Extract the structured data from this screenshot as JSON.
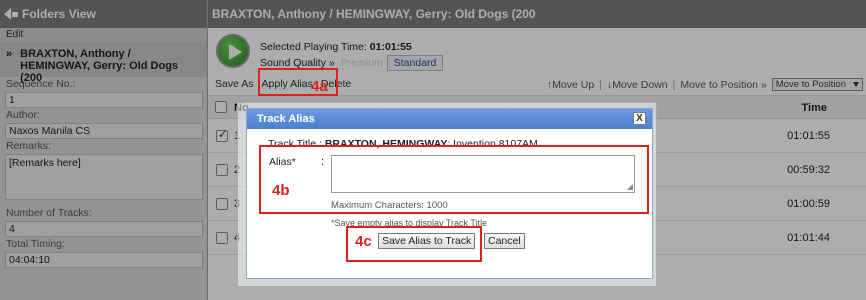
{
  "sidebar": {
    "header": "Folders View",
    "edit": "Edit",
    "item_bullet": "»",
    "item_title": "BRAXTON, Anthony / HEMINGWAY, Gerry: Old Dogs (200",
    "sequence_label": "Sequence No.:",
    "sequence_value": "1",
    "author_label": "Author:",
    "author_value": "Naxos Manila CS",
    "remarks_label": "Remarks:",
    "remarks_value": "[Remarks here]",
    "tracks_label": "Number of Tracks:",
    "tracks_value": "4",
    "timing_label": "Total Timing:",
    "timing_value": "04:04:10"
  },
  "main": {
    "title": "BRAXTON, Anthony / HEMINGWAY, Gerry: Old Dogs (200",
    "playing_label": "Selected Playing Time:",
    "playing_value": "01:01:55",
    "quality_label": "Sound Quality",
    "quality_sep": "»",
    "premium": "Premium",
    "standard": "Standard",
    "toolbar": {
      "save_as": "Save As",
      "apply_alias": "Apply Alias",
      "delete": "Delete",
      "move_up": "↑Move Up",
      "move_down": "↓Move Down",
      "sep": "|",
      "move_to_position": "Move to Position »",
      "select_value": "Move to Position"
    },
    "table": {
      "col_no": "No",
      "col_time": "Time",
      "rows": [
        {
          "num": "1",
          "time": "01:01:55",
          "checked": true
        },
        {
          "num": "2",
          "time": "00:59:32",
          "checked": false
        },
        {
          "num": "3",
          "time": "01:00:59",
          "checked": false
        },
        {
          "num": "4",
          "time": "01:01:44",
          "checked": false
        }
      ]
    }
  },
  "modal": {
    "title": "Track Alias",
    "close": "X",
    "track_title_label": "Track Title",
    "track_colon": ":",
    "track_title_bold": "BRAXTON, HEMINGWAY",
    "track_title_rest": ": Invention 8107AM",
    "alias_label": "Alias*",
    "alias_colon": ":",
    "alias_value": "",
    "max_chars": "Maximum Characters: 1000",
    "hint": "*Save empty alias to display Track Title",
    "save_button": "Save Alias to Track",
    "cancel_button": "Cancel"
  },
  "annotations": {
    "a": "4a",
    "b": "4b",
    "c": "4c",
    "color": "#e0201b"
  }
}
